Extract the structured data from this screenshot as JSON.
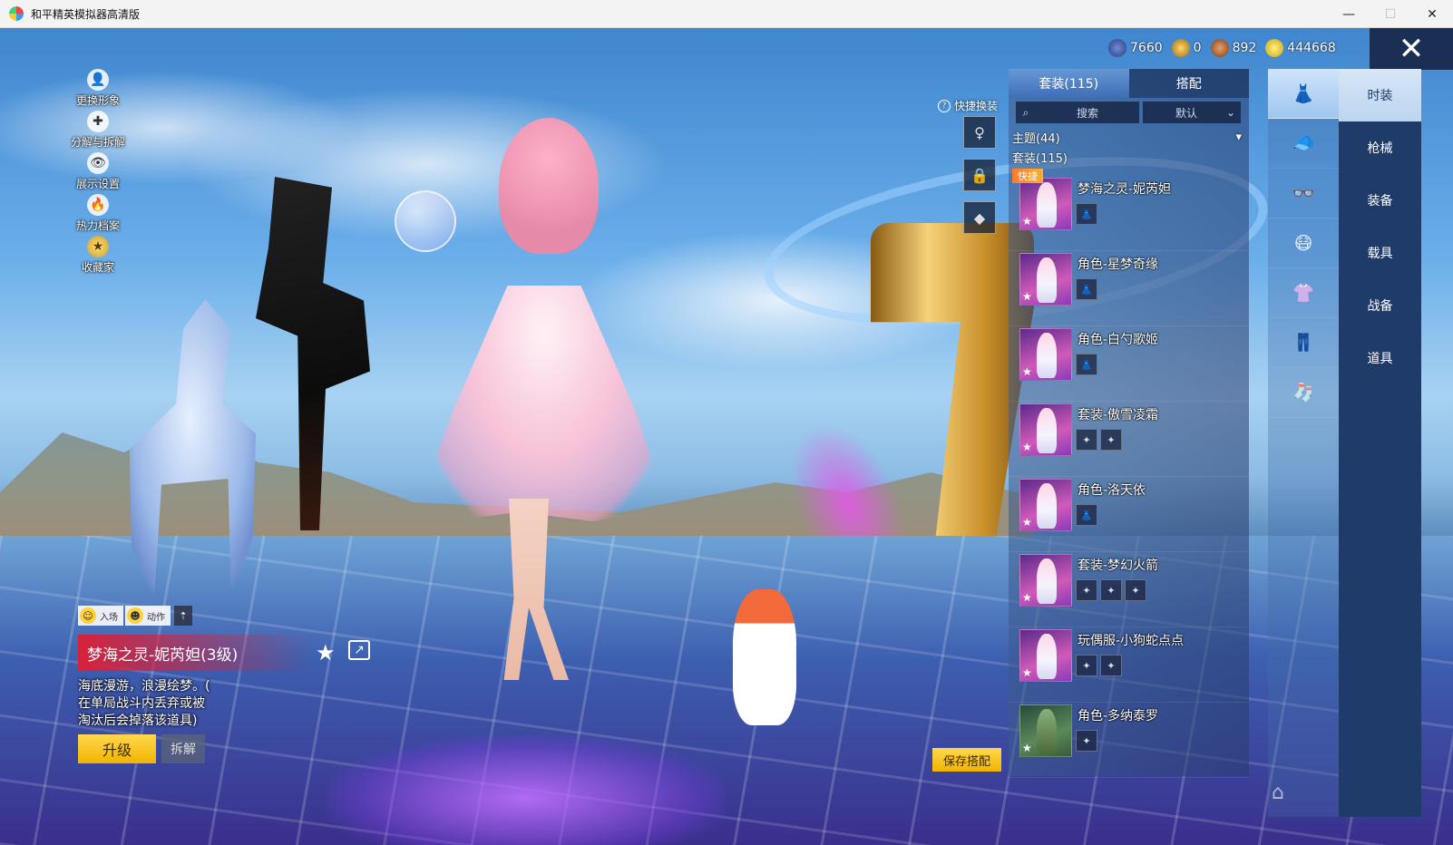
{
  "window": {
    "title": "和平精英模拟器高清版",
    "minimize": "—",
    "maximize": "☐",
    "close": "✕"
  },
  "left_menu": [
    {
      "label": "更换形象",
      "icon": "👤"
    },
    {
      "label": "分解与拆解",
      "icon": "✚"
    },
    {
      "label": "展示设置",
      "icon": "👁"
    },
    {
      "label": "热力档案",
      "icon": "🔥"
    },
    {
      "label": "收藏家",
      "icon": "★"
    }
  ],
  "action_bar": {
    "entrance": "入场",
    "action": "动作",
    "collapse": "⇡"
  },
  "item": {
    "title": "梦海之灵-妮芮妲(3级)",
    "desc_line1": "海底漫游，浪漫绘梦。(",
    "desc_line2": "在单局战斗内丢弃或被",
    "desc_line3": "淘汰后会掉落该道具)",
    "upgrade": "升级",
    "dismantle": "拆解",
    "star": "★",
    "share": "↗"
  },
  "currencies": [
    "7660",
    "0",
    "892",
    "444668"
  ],
  "close_icon": "✕",
  "quick_change": {
    "label": "快捷换装",
    "q": "?"
  },
  "panel": {
    "tab_suits": "套装(115)",
    "tab_match": "搭配",
    "search_placeholder": "搜索",
    "sort": "默认",
    "group_theme": "主题(44)",
    "group_suit": "套装(115)",
    "quick_tag": "快捷"
  },
  "outfits": [
    {
      "name": "梦海之灵-妮芮妲",
      "parts": [
        "👗"
      ]
    },
    {
      "name": "角色-星梦奇缘",
      "parts": [
        "👗"
      ]
    },
    {
      "name": "角色-白勺歌姬",
      "parts": [
        "👗"
      ]
    },
    {
      "name": "套装-傲雪凌霜",
      "parts": [
        "✦",
        "✦"
      ]
    },
    {
      "name": "角色-洛天依",
      "parts": [
        "👗"
      ]
    },
    {
      "name": "套装-梦幻火箭",
      "parts": [
        "✦",
        "✦",
        "✦"
      ]
    },
    {
      "name": "玩偶服-小狗蛇点点",
      "parts": [
        "✦",
        "✦"
      ]
    },
    {
      "name": "角色-多纳泰罗",
      "parts": [
        "✦"
      ]
    }
  ],
  "categories": [
    "时装",
    "枪械",
    "装备",
    "载具",
    "战备",
    "道具"
  ],
  "slots": [
    "👗",
    "🧢",
    "👓",
    "😷",
    "👚",
    "👖",
    "🧦"
  ],
  "save": "保存搭配"
}
